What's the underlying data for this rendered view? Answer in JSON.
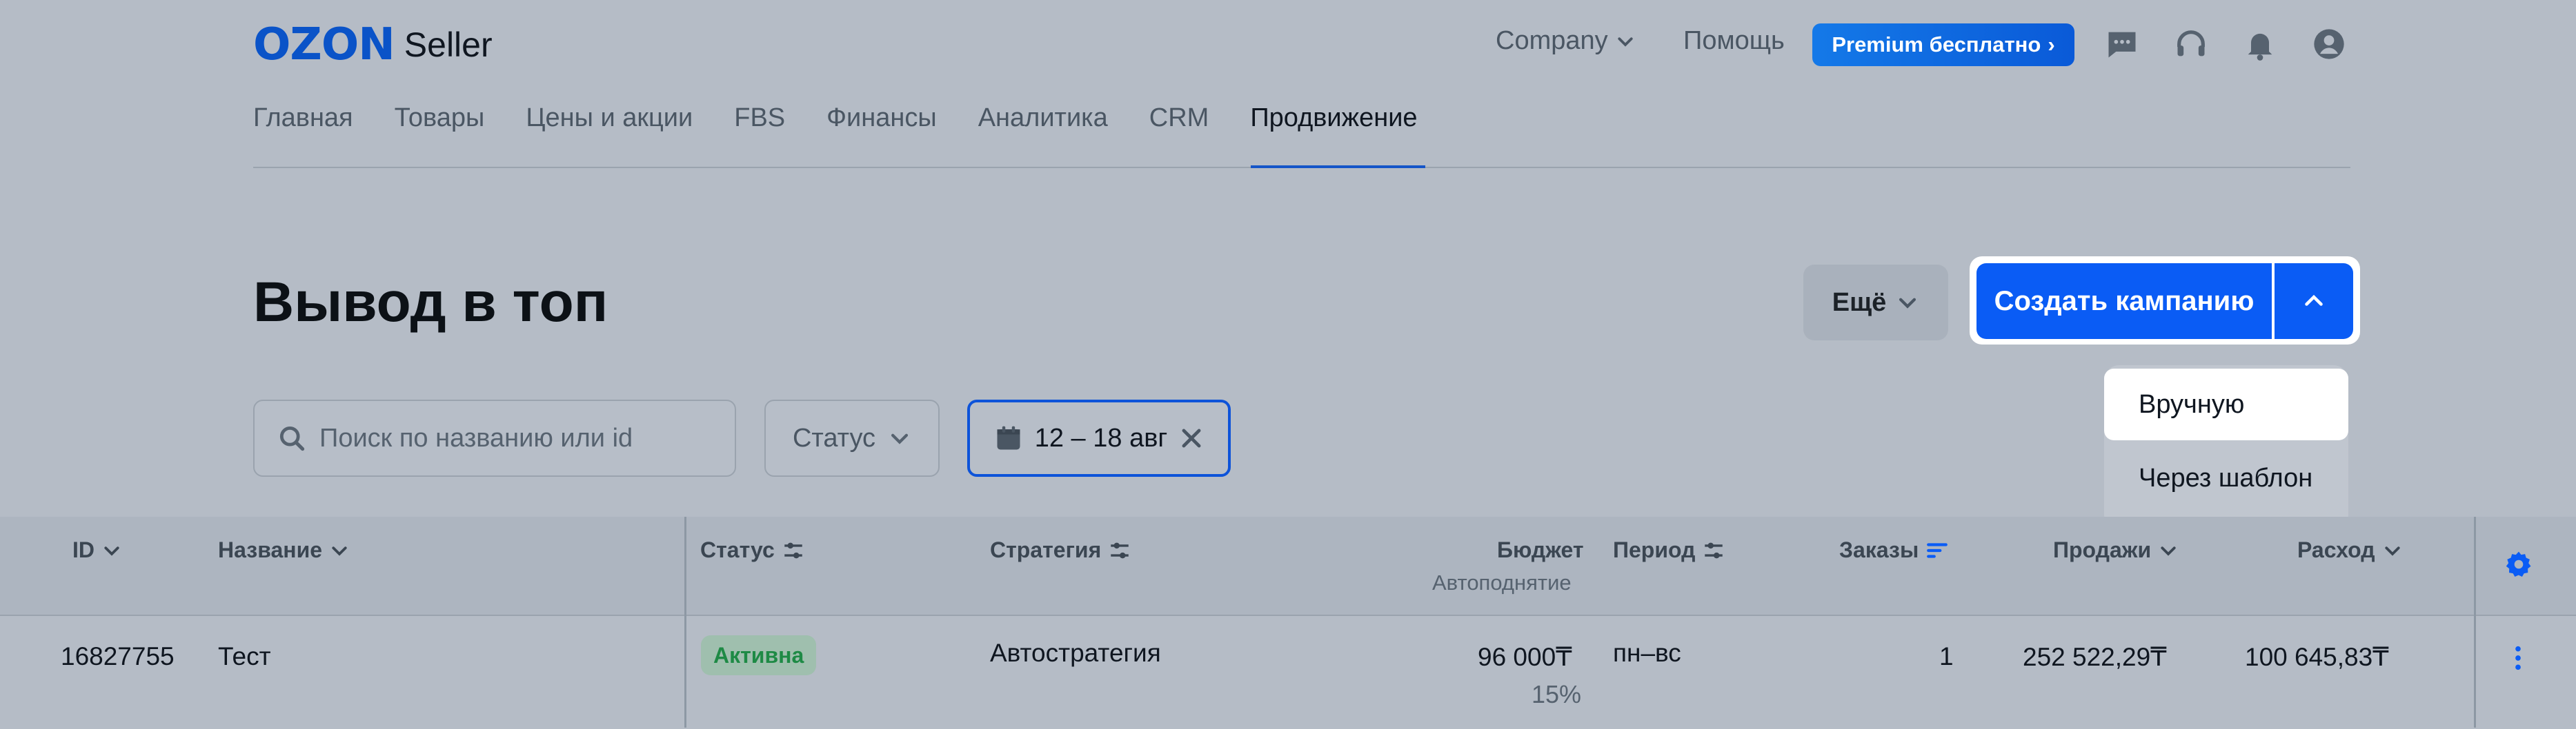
{
  "header": {
    "logo_ozon": "OZON",
    "logo_seller": "Seller",
    "company_label": "Company",
    "help_label": "Помощь",
    "premium_label": "Premium бесплатно"
  },
  "tabs": [
    {
      "label": "Главная"
    },
    {
      "label": "Товары"
    },
    {
      "label": "Цены и акции"
    },
    {
      "label": "FBS"
    },
    {
      "label": "Финансы"
    },
    {
      "label": "Аналитика"
    },
    {
      "label": "CRM"
    },
    {
      "label": "Продвижение",
      "active": true
    }
  ],
  "page": {
    "title": "Вывод в топ",
    "more_label": "Ещё",
    "create_label": "Создать кампанию"
  },
  "create_menu": {
    "items": [
      "Вручную",
      "Через шаблон"
    ]
  },
  "filters": {
    "search_placeholder": "Поиск по названию или id",
    "status_label": "Статус",
    "date_label": "12 – 18 авг"
  },
  "table": {
    "headers": {
      "id": "ID",
      "name": "Название",
      "status": "Статус",
      "strategy": "Стратегия",
      "budget": "Бюджет",
      "budget_sub": "Автоподнятие",
      "period": "Период",
      "orders": "Заказы",
      "sales": "Продажи",
      "expense": "Расход"
    },
    "rows": [
      {
        "id": "16827755",
        "name": "Тест",
        "status": "Активна",
        "strategy": "Автостратегия",
        "budget": "96 000₸",
        "budget_sub": "15%",
        "period": "пн–вс",
        "orders": "1",
        "sales": "252 522,29₸",
        "expense": "100 645,83₸"
      }
    ]
  },
  "colors": {
    "accent": "#0a5cf5",
    "brand": "#0a53c8",
    "active_status": "#1e8a45"
  }
}
